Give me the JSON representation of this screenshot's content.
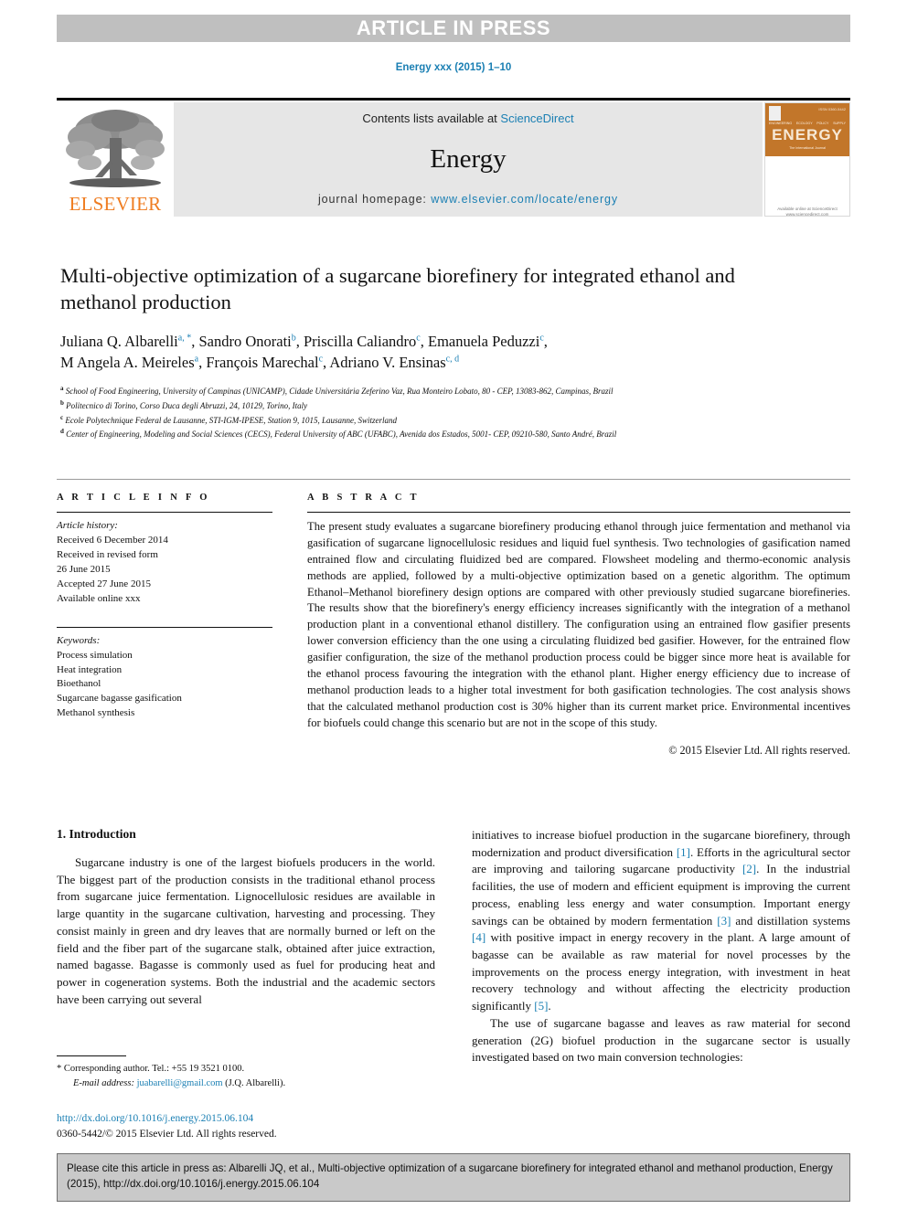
{
  "banner": {
    "text": "ARTICLE IN PRESS"
  },
  "running_head": "Energy xxx (2015) 1–10",
  "masthead": {
    "contents_prefix": "Contents lists available at ",
    "contents_link": "ScienceDirect",
    "journal_name": "Energy",
    "homepage_prefix": "journal homepage: ",
    "homepage_url": "www.elsevier.com/locate/energy",
    "publisher": "ELSEVIER",
    "cover": {
      "title": "ENERGY",
      "issue": "ISSN 0360-5442",
      "keywords": [
        "ENGINEERING",
        "ECOLOGY",
        "POLICY",
        "SUPPLY"
      ],
      "subtitle": "The International Journal",
      "footer": "Available online at\nScienceDirect\nwww.sciencedirect.com"
    }
  },
  "article": {
    "title": "Multi-objective optimization of a sugarcane biorefinery for integrated ethanol and methanol production",
    "authors_line_1_parts": [
      {
        "name": "Juliana Q. Albarelli",
        "marks": "a, *"
      },
      {
        "name": "Sandro Onorati",
        "marks": "b"
      },
      {
        "name": "Priscilla Caliandro",
        "marks": "c"
      },
      {
        "name": "Emanuela Peduzzi",
        "marks": "c"
      }
    ],
    "authors_line_2_parts": [
      {
        "name": "M Angela A. Meireles",
        "marks": "a"
      },
      {
        "name": "François Marechal",
        "marks": "c"
      },
      {
        "name": "Adriano V. Ensinas",
        "marks": "c, d"
      }
    ],
    "affiliations": [
      {
        "mark": "a",
        "text": "School of Food Engineering, University of Campinas (UNICAMP), Cidade Universitária Zeferino Vaz, Rua Monteiro Lobato, 80 - CEP, 13083-862, Campinas, Brazil"
      },
      {
        "mark": "b",
        "text": "Politecnico di Torino, Corso Duca degli Abruzzi, 24, 10129, Torino, Italy"
      },
      {
        "mark": "c",
        "text": "Ecole Polytechnique Federal de Lausanne, STI-IGM-IPESE, Station 9, 1015, Lausanne, Switzerland"
      },
      {
        "mark": "d",
        "text": "Center of Engineering, Modeling and Social Sciences (CECS), Federal University of ABC (UFABC), Avenida dos Estados, 5001- CEP, 09210-580, Santo André, Brazil"
      }
    ]
  },
  "article_info": {
    "heading": "A R T I C L E   I N F O",
    "history_label": "Article history:",
    "history": [
      "Received 6 December 2014",
      "Received in revised form",
      "26 June 2015",
      "Accepted 27 June 2015",
      "Available online xxx"
    ],
    "keywords_label": "Keywords:",
    "keywords": [
      "Process simulation",
      "Heat integration",
      "Bioethanol",
      "Sugarcane bagasse gasification",
      "Methanol synthesis"
    ]
  },
  "abstract": {
    "heading": "A B S T R A C T",
    "text": "The present study evaluates a sugarcane biorefinery producing ethanol through juice fermentation and methanol via gasification of sugarcane lignocellulosic residues and liquid fuel synthesis. Two technologies of gasification named entrained flow and circulating fluidized bed are compared. Flowsheet modeling and thermo-economic analysis methods are applied, followed by a multi-objective optimization based on a genetic algorithm. The optimum Ethanol–Methanol biorefinery design options are compared with other previously studied sugarcane biorefineries. The results show that the biorefinery's energy efficiency increases significantly with the integration of a methanol production plant in a conventional ethanol distillery. The configuration using an entrained flow gasifier presents lower conversion efficiency than the one using a circulating fluidized bed gasifier. However, for the entrained flow gasifier configuration, the size of the methanol production process could be bigger since more heat is available for the ethanol process favouring the integration with the ethanol plant. Higher energy efficiency due to increase of methanol production leads to a higher total investment for both gasification technologies. The cost analysis shows that the calculated methanol production cost is 30% higher than its current market price. Environmental incentives for biofuels could change this scenario but are not in the scope of this study.",
    "copyright": "© 2015 Elsevier Ltd. All rights reserved."
  },
  "introduction": {
    "heading": "1. Introduction",
    "left_paragraph": "Sugarcane industry is one of the largest biofuels producers in the world. The biggest part of the production consists in the traditional ethanol process from sugarcane juice fermentation. Lignocellulosic residues are available in large quantity in the sugarcane cultivation, harvesting and processing. They consist mainly in green and dry leaves that are normally burned or left on the field and the fiber part of the sugarcane stalk, obtained after juice extraction, named bagasse. Bagasse is commonly used as fuel for producing heat and power in cogeneration systems. Both the industrial and the academic sectors have been carrying out several",
    "right_paragraph_1": "initiatives to increase biofuel production in the sugarcane biorefinery, through modernization and product diversification [1]. Efforts in the agricultural sector are improving and tailoring sugarcane productivity [2]. In the industrial facilities, the use of modern and efficient equipment is improving the current process, enabling less energy and water consumption. Important energy savings can be obtained by modern fermentation [3] and distillation systems [4] with positive impact in energy recovery in the plant. A large amount of bagasse can be available as raw material for novel processes by the improvements on the process energy integration, with investment in heat recovery technology and without affecting the electricity production significantly [5].",
    "right_paragraph_2": "The use of sugarcane bagasse and leaves as raw material for second generation (2G) biofuel production in the sugarcane sector is usually investigated based on two main conversion technologies:"
  },
  "footnote": {
    "corresponding": "* Corresponding author. Tel.: +55 19 3521 0100.",
    "email_label": "E-mail address: ",
    "email": "juabarelli@gmail.com",
    "email_suffix": " (J.Q. Albarelli)."
  },
  "doi_block": {
    "doi": "http://dx.doi.org/10.1016/j.energy.2015.06.104",
    "issn": "0360-5442/© 2015 Elsevier Ltd. All rights reserved."
  },
  "cite_box": {
    "text": "Please cite this article in press as: Albarelli JQ, et al., Multi-objective optimization of a sugarcane biorefinery for integrated ethanol and methanol production, Energy (2015), http://dx.doi.org/10.1016/j.energy.2015.06.104"
  },
  "colors": {
    "link": "#1a7fb3",
    "banner_bg": "#bfbfbf",
    "elsevier_orange": "#ef7d22",
    "cover_orange": "#c2762a",
    "cite_bg": "#c9c9c9"
  }
}
